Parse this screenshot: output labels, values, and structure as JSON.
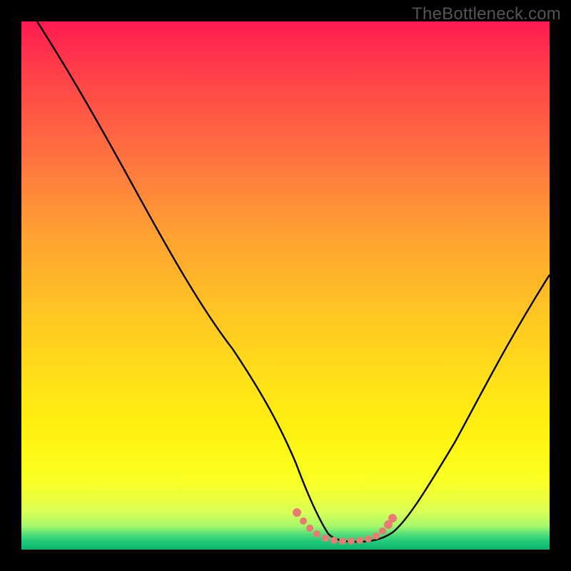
{
  "watermark": "TheBottleneck.com",
  "chart_data": {
    "type": "line",
    "title": "",
    "xlabel": "",
    "ylabel": "",
    "xlim": [
      0,
      100
    ],
    "ylim": [
      0,
      100
    ],
    "grid": false,
    "legend": false,
    "series": [
      {
        "name": "curve",
        "x": [
          3,
          10,
          20,
          30,
          40,
          48,
          52,
          55,
          58,
          62,
          66,
          70,
          75,
          82,
          90,
          100
        ],
        "y": [
          100,
          88,
          71,
          54,
          38,
          22,
          12,
          6,
          3,
          2,
          2,
          3,
          6,
          15,
          30,
          52
        ],
        "color": "#000000"
      },
      {
        "name": "highlight",
        "x": [
          52,
          54,
          56,
          58,
          60,
          62,
          64,
          66,
          68,
          70
        ],
        "y": [
          7,
          5,
          3.5,
          2.5,
          2,
          2,
          2.2,
          2.8,
          4,
          6
        ],
        "color": "#e97b72",
        "style": "dotted"
      }
    ],
    "background_gradient": [
      "#ff1a52",
      "#ffc524",
      "#fff210",
      "#1ec97a"
    ],
    "annotations": []
  }
}
